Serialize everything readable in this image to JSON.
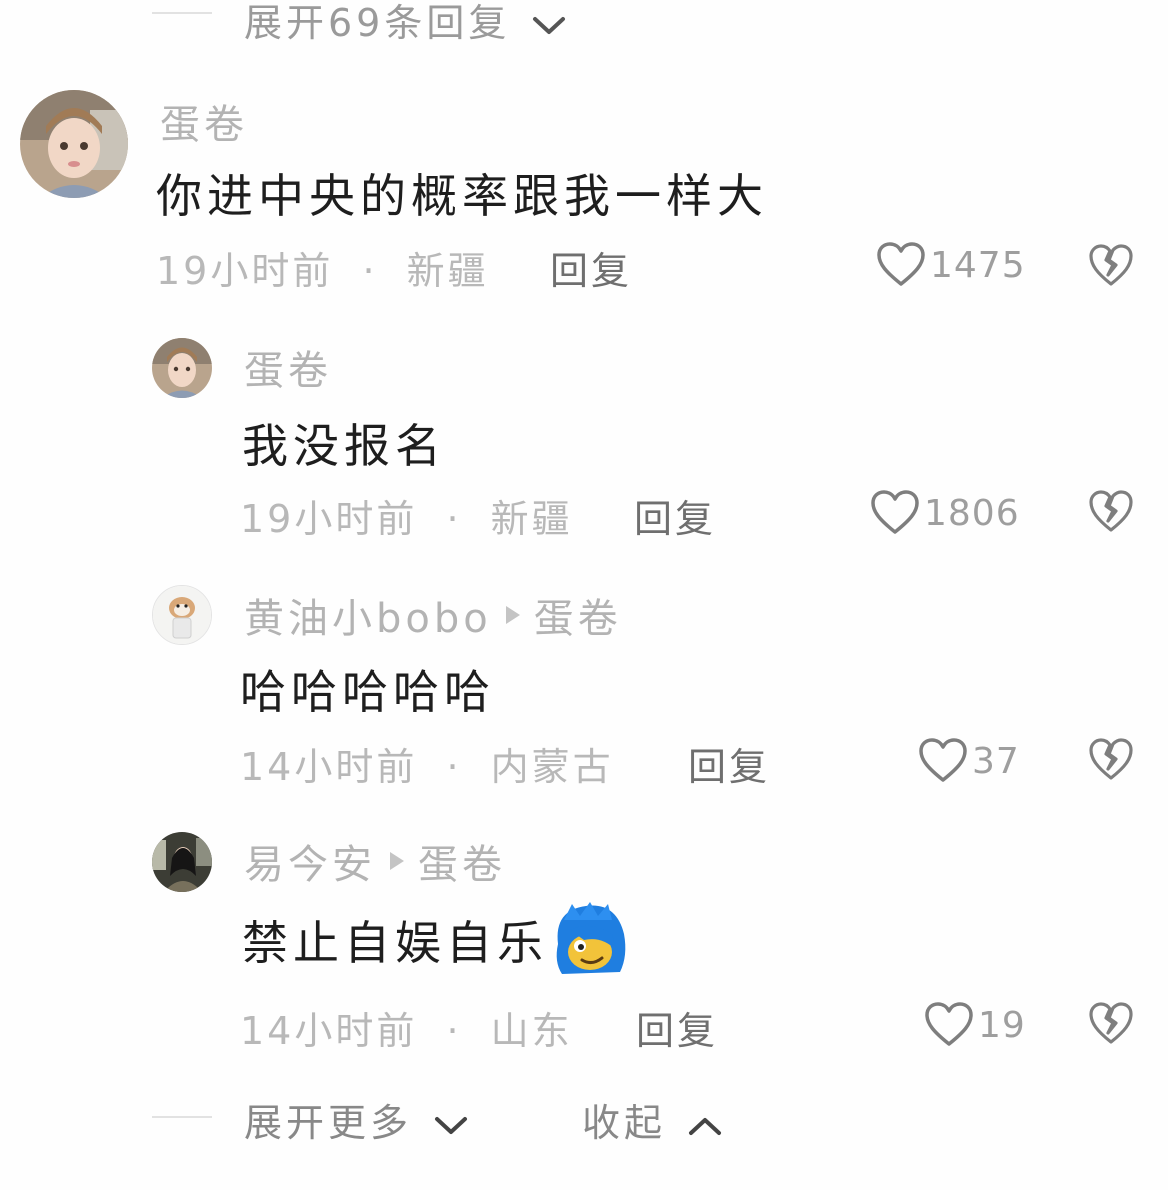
{
  "top_expand": {
    "label": "展开69条回复"
  },
  "comments": [
    {
      "username": "蛋卷",
      "text": "你进中央的概率跟我一样大",
      "time": "19小时前",
      "location": "新疆",
      "reply_label": "回复",
      "likes": "1475"
    },
    {
      "username": "蛋卷",
      "text": "我没报名",
      "time": "19小时前",
      "location": "新疆",
      "reply_label": "回复",
      "likes": "1806"
    },
    {
      "username": "黄油小bobo",
      "reply_to": "蛋卷",
      "text": "哈哈哈哈哈",
      "time": "14小时前",
      "location": "内蒙古",
      "reply_label": "回复",
      "likes": "37"
    },
    {
      "username": "易今安",
      "reply_to": "蛋卷",
      "text": "禁止自娱自乐",
      "emoji": "blue-hair-face-emoji",
      "time": "14小时前",
      "location": "山东",
      "reply_label": "回复",
      "likes": "19"
    }
  ],
  "footer": {
    "expand_more": "展开更多",
    "collapse": "收起"
  },
  "separator": "·",
  "icons": {
    "like": "heart-outline-icon",
    "dislike": "broken-heart-icon",
    "expand": "chevron-down-icon",
    "collapse": "chevron-up-icon"
  },
  "colors": {
    "meta_gray": "#b8b8b8",
    "icon_gray": "#8a8a8a",
    "text": "#1e1e1e"
  }
}
